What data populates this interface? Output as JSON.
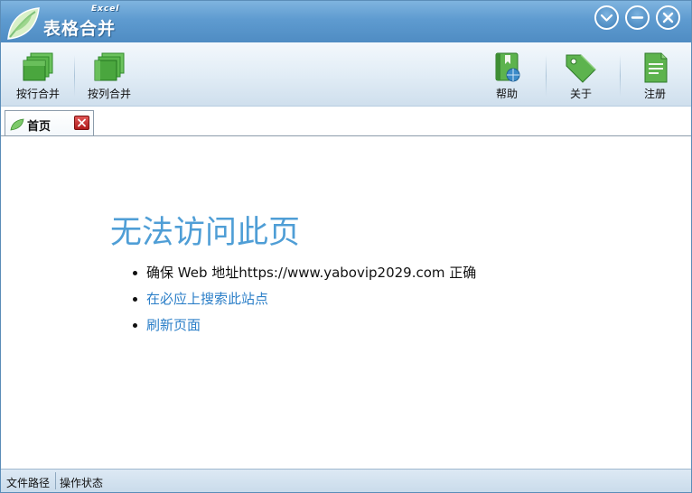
{
  "window": {
    "title": "表格合并",
    "subtitle": "Excel",
    "colors": {
      "titlebar": "#5e9bd0",
      "accent": "#4f9ed6",
      "link": "#2c7fc8"
    }
  },
  "window_controls": [
    {
      "name": "dropdown",
      "icon": "chevron-down-icon"
    },
    {
      "name": "minimize",
      "icon": "minimize-icon"
    },
    {
      "name": "close",
      "icon": "close-icon"
    }
  ],
  "toolbar": {
    "merge_rows_label": "按行合并",
    "merge_cols_label": "按列合并",
    "help_label": "帮助",
    "about_label": "关于",
    "register_label": "注册"
  },
  "tabs": [
    {
      "label": "首页",
      "icon": "leaf-icon",
      "active": true
    }
  ],
  "content": {
    "error_title": "无法访问此页",
    "item1_prefix": "确保 Web 地址",
    "item1_url": "https://www.yabovip2029.com",
    "item1_suffix": " 正确",
    "item2_link": "在必应上搜索此站点",
    "item3_link": "刷新页面"
  },
  "statusbar": {
    "file_path": "文件路径",
    "operation_status": "操作状态"
  }
}
